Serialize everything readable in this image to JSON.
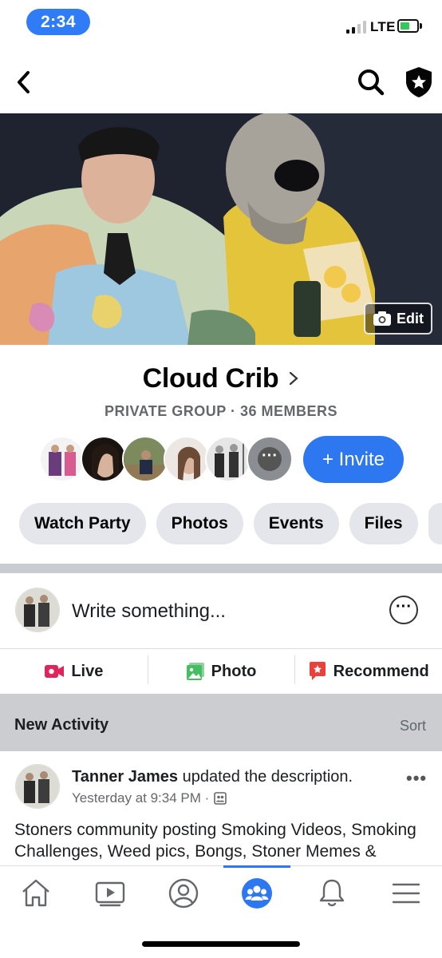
{
  "status_bar": {
    "time": "2:34",
    "network": "LTE"
  },
  "cover": {
    "edit_label": "Edit"
  },
  "group": {
    "name": "Cloud Crib",
    "subtitle": "PRIVATE GROUP · 36 MEMBERS",
    "invite_label": "+ Invite",
    "member_more": "···"
  },
  "chips": [
    "Watch Party",
    "Photos",
    "Events",
    "Files"
  ],
  "composer": {
    "placeholder": "Write something...",
    "more": "···"
  },
  "actions": {
    "live": "Live",
    "photo": "Photo",
    "recommend": "Recommend"
  },
  "activity": {
    "title": "New Activity",
    "sort": "Sort"
  },
  "post": {
    "author": "Tanner James",
    "action": " updated the description.",
    "time": "Yesterday at 9:34 PM ·",
    "body": "Stoners community posting Smoking Videos, Smoking Challenges, Weed pics, Bongs, Stoner Memes &",
    "more": "•••"
  },
  "colors": {
    "accent": "#2d78f0",
    "live": "#e0245e",
    "photo": "#45bd62",
    "recommend": "#e9413b"
  }
}
